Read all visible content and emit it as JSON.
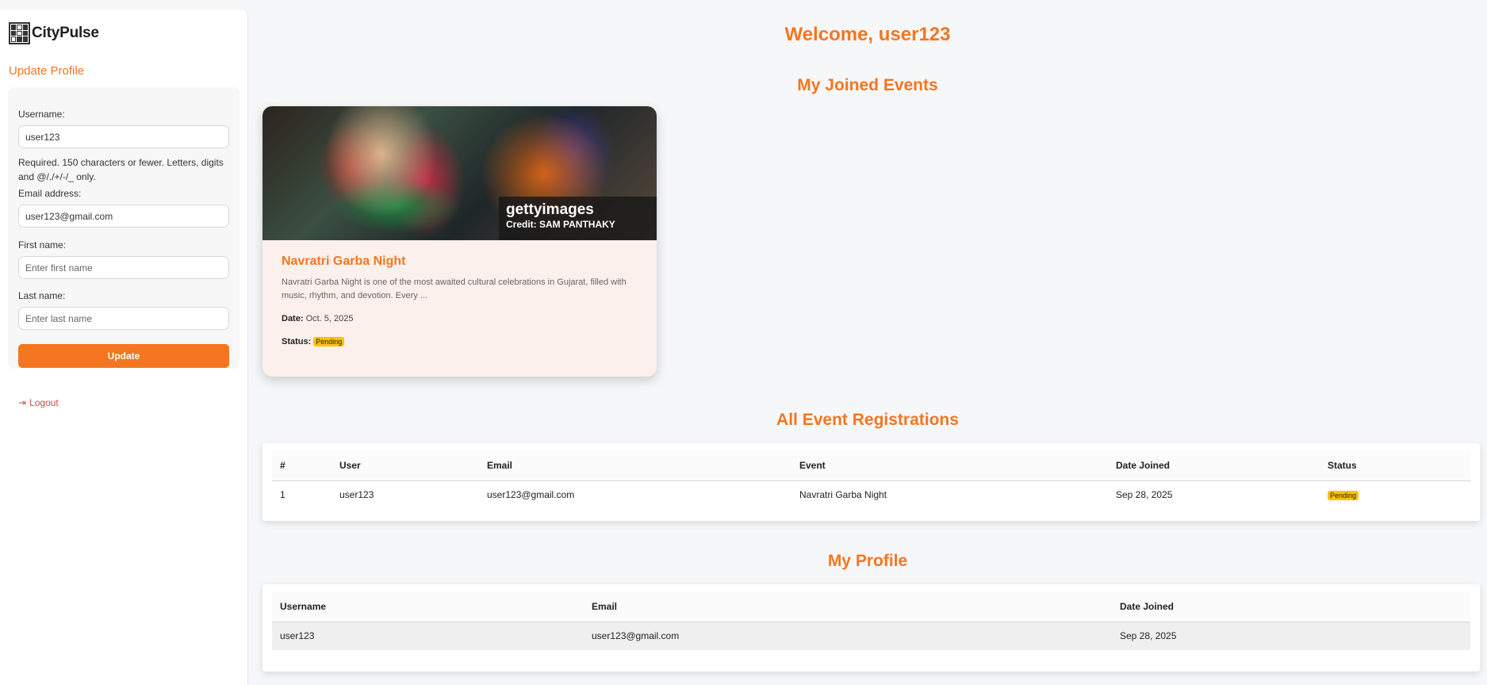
{
  "brand": {
    "name": "CityPulse"
  },
  "sidebar": {
    "section_title": "Update Profile",
    "fields": {
      "username_label": "Username:",
      "username_value": "user123",
      "username_help": "Required. 150 characters or fewer. Letters, digits and @/./+/-/_ only.",
      "email_label": "Email address:",
      "email_value": "user123@gmail.com",
      "first_name_label": "First name:",
      "first_name_placeholder": "Enter first name",
      "last_name_label": "Last name:",
      "last_name_placeholder": "Enter last name"
    },
    "update_button": "Update",
    "logout_icon": "logout-icon",
    "logout": "Logout"
  },
  "main": {
    "welcome": "Welcome, user123",
    "joined_events_title": "My Joined Events",
    "event": {
      "image_watermark": "gettyimages",
      "image_credit": "Credit: SAM PANTHAKY",
      "title": "Navratri Garba Night",
      "description": "Navratri Garba Night is one of the most awaited cultural celebrations in Gujarat, filled with music, rhythm, and devotion. Every ...",
      "date_label": "Date:",
      "date": "Oct. 5, 2025",
      "status_label": "Status:",
      "status": "Pending"
    },
    "registrations_title": "All Event Registrations",
    "registrations_table": {
      "headers": [
        "#",
        "User",
        "Email",
        "Event",
        "Date Joined",
        "Status"
      ],
      "rows": [
        {
          "number": "1",
          "user": "user123",
          "email": "user123@gmail.com",
          "event": "Navratri Garba Night",
          "date_joined": "Sep 28, 2025",
          "status": "Pending"
        }
      ]
    },
    "profile_title": "My Profile",
    "profile_table": {
      "headers": [
        "Username",
        "Email",
        "Date Joined"
      ],
      "rows": [
        {
          "username": "user123",
          "email": "user123@gmail.com",
          "date_joined": "Sep 28, 2025"
        }
      ]
    }
  },
  "colors": {
    "accent": "#f47620",
    "background": "#f6f7f9",
    "badge_pending": "#ffc107",
    "logout": "#d34b4b"
  }
}
